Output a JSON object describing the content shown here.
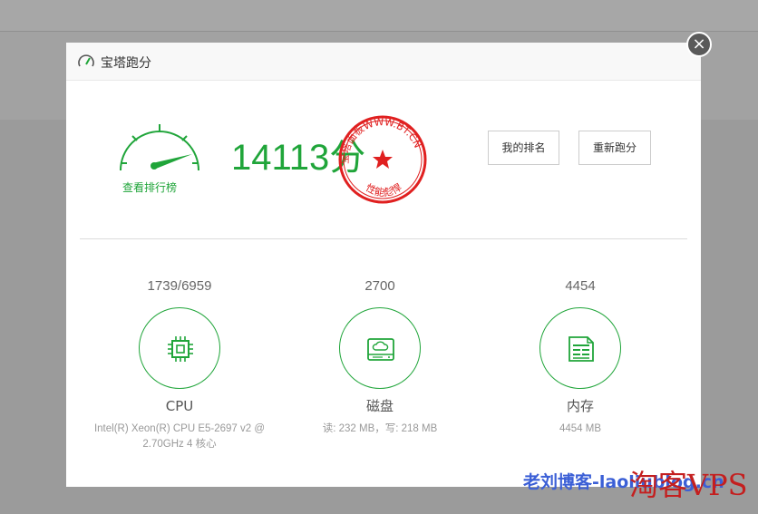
{
  "dialog": {
    "title": "宝塔跑分",
    "close_symbol": "×"
  },
  "score": {
    "value": "14113",
    "unit": "分",
    "rank_link": "查看排行榜"
  },
  "stamp": {
    "outer_text": "宝塔面板WWW.BT.CN",
    "bottom_text": "性能彪悍",
    "color": "#e02020"
  },
  "buttons": {
    "my_rank": "我的排名",
    "rerun": "重新跑分"
  },
  "metrics": {
    "cpu": {
      "value": "1739/6959",
      "label": "CPU",
      "desc": "Intel(R) Xeon(R) CPU E5-2697 v2 @ 2.70GHz 4 核心",
      "icon": "cpu-chip-icon"
    },
    "disk": {
      "value": "2700",
      "label": "磁盘",
      "desc": "读: 232 MB，写: 218 MB",
      "icon": "hard-disk-icon"
    },
    "memory": {
      "value": "4454",
      "label": "内存",
      "desc": "4454 MB",
      "icon": "memory-document-icon"
    }
  },
  "watermark": {
    "blue": "老刘博客-laoliublog.cn",
    "red": "淘客VPS"
  },
  "colors": {
    "accent": "#20a53a",
    "overlay": "#9b9b9b",
    "stamp": "#e02020"
  }
}
